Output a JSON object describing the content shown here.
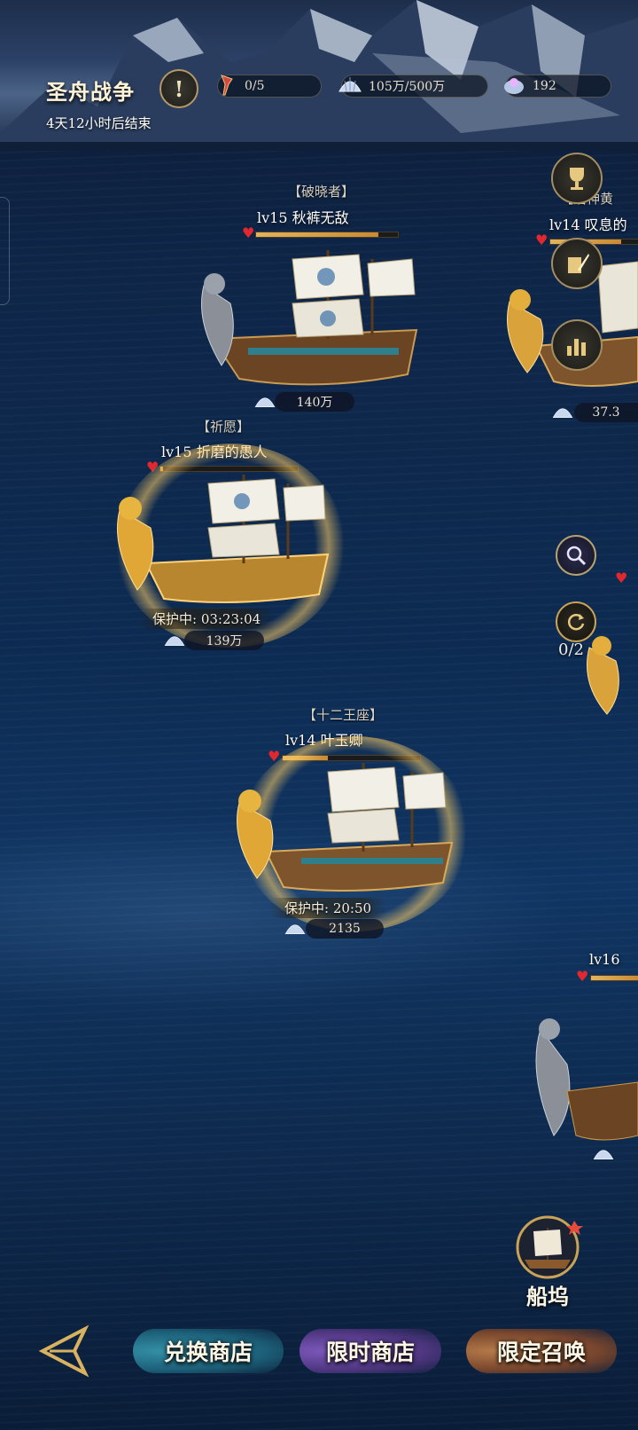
{
  "event": {
    "title": "圣舟战争",
    "countdown": "4天12小时后结束",
    "info_glyph": "!"
  },
  "resources": [
    {
      "icon": "flare-icon",
      "value": "0/5"
    },
    {
      "icon": "shell-icon",
      "value": "105万/500万"
    },
    {
      "icon": "gem-shell-icon",
      "value": "192"
    }
  ],
  "ships": [
    {
      "guild": "【破晓者】",
      "level_name": "lv15 秋裤无敌",
      "hp": 0.86,
      "value": "140万",
      "protected": false
    },
    {
      "guild": "【祈愿】",
      "level_name": "lv15 折磨的愚人",
      "hp": 0.02,
      "shield_label": "保护中: 03:23:04",
      "value": "139万",
      "protected": true
    },
    {
      "guild": "【十二王座】",
      "level_name": "lv14 叶玉卿",
      "hp": 0.33,
      "shield_label": "保护中: 20:50",
      "value": "2135",
      "protected": true
    }
  ],
  "partial_ships": [
    {
      "guild": "【治神黄",
      "level_name": "lv14 叹息的",
      "value": "37.3"
    },
    {
      "level_name": "lv16"
    }
  ],
  "side": {
    "search_count": "0/2"
  },
  "dock": {
    "label": "船坞"
  },
  "nav": [
    {
      "label": "兑换商店",
      "color": "#1f6a82"
    },
    {
      "label": "限时商店",
      "color": "#5b3a8c"
    },
    {
      "label": "限定召唤",
      "color": "#8a4b2a"
    }
  ]
}
